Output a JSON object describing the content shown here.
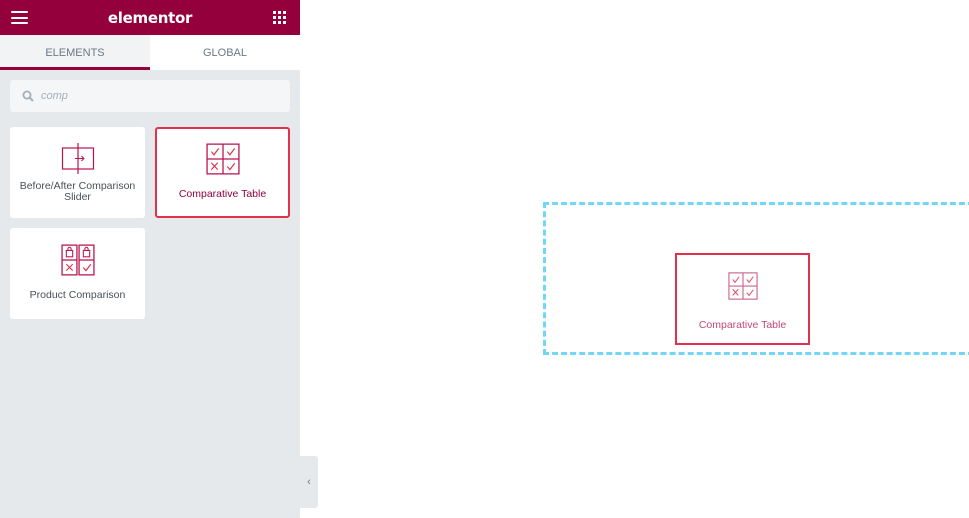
{
  "header": {
    "brand": "elementor",
    "menu_icon": "hamburger-icon",
    "apps_icon": "grid-icon",
    "background": "#93003c"
  },
  "tabs": [
    {
      "label": "ELEMENTS",
      "active": true
    },
    {
      "label": "GLOBAL",
      "active": false
    }
  ],
  "search": {
    "value": "",
    "placeholder": "comp",
    "icon": "search-icon"
  },
  "widgets": [
    {
      "label": "Before/After Comparison Slider",
      "icon": "before-after-slider-icon",
      "selected": false
    },
    {
      "label": "Comparative Table",
      "icon": "comparative-table-icon",
      "selected": true
    },
    {
      "label": "Product Comparison",
      "icon": "product-comparison-icon",
      "selected": false
    }
  ],
  "canvas": {
    "dragged_widget": {
      "label": "Comparative Table",
      "icon": "comparative-table-icon"
    },
    "dropzone_color": "#71d7f7"
  },
  "collapse_toggle": {
    "icon": "chevron-left-icon",
    "glyph": "‹"
  },
  "colors": {
    "accent": "#93003c",
    "highlight": "#e2304d",
    "icon": "#b9144f"
  }
}
